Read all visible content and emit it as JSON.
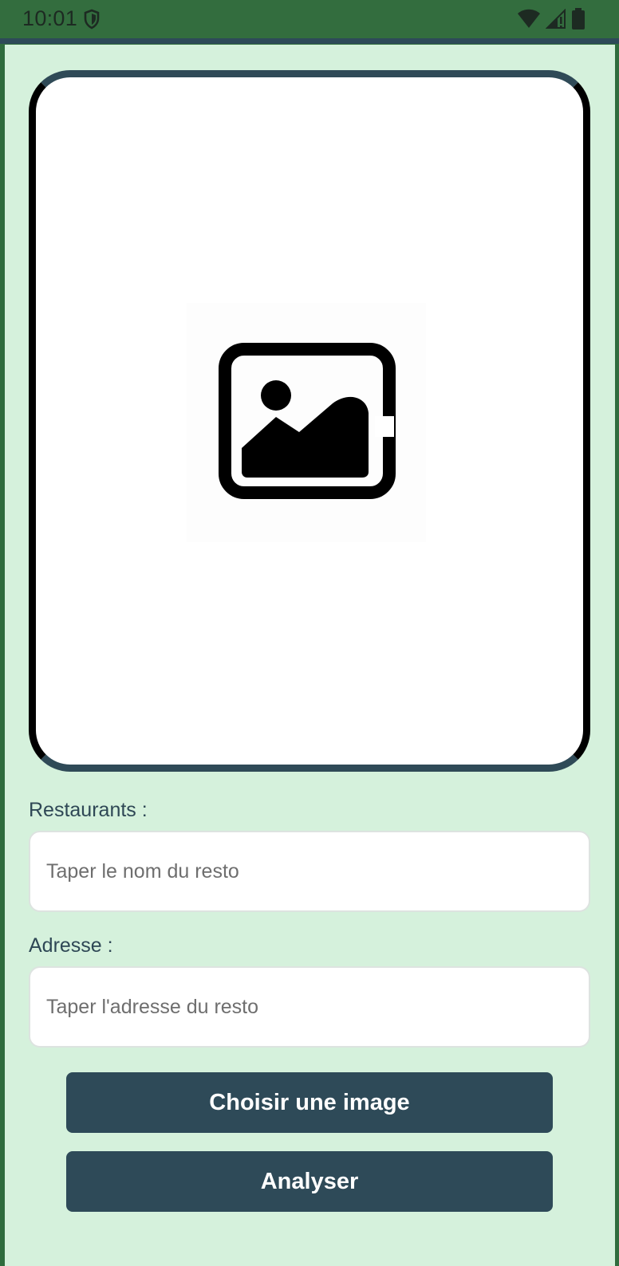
{
  "status_bar": {
    "time": "10:01",
    "icons": [
      "shield-icon",
      "wifi-icon",
      "cellular-signal-icon",
      "battery-icon"
    ]
  },
  "image_card": {
    "placeholder_icon": "image-placeholder-icon"
  },
  "form": {
    "restaurant_label": "Restaurants :",
    "restaurant_placeholder": "Taper le nom du resto",
    "restaurant_value": "",
    "address_label": "Adresse :",
    "address_placeholder": "Taper l'adresse du resto",
    "address_value": ""
  },
  "buttons": {
    "choose_image": "Choisir une image",
    "analyze": "Analyser"
  },
  "colors": {
    "status_bar": "#336d3e",
    "background": "#d5f1dc",
    "accent": "#2e4a58",
    "card": "#ffffff"
  }
}
